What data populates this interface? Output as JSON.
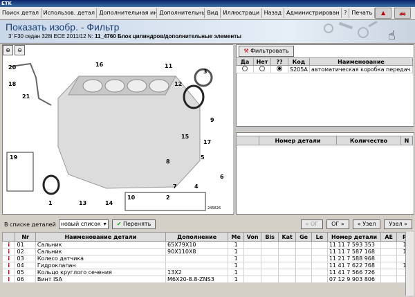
{
  "app": {
    "title": "ETK"
  },
  "menu": {
    "items": [
      "Поиск детал",
      "Использов. детал",
      "Дополнительная ин",
      "Дополнительны",
      "Вид",
      "Иллюстраци",
      "Назад",
      "Администрирован",
      "?",
      "Печать"
    ]
  },
  "header": {
    "title": "Показать изобр. - Фильтр",
    "subtitle_prefix": "3' F30 седан 328i ECE 2011/12 N: ",
    "subtitle_code": "11_4760",
    "subtitle_suffix": " Блок цилиндров/дополнительные элементы"
  },
  "filter": {
    "button": "Фильтровать",
    "columns": [
      "Да",
      "Нет",
      "??",
      "Код",
      "Наименование"
    ],
    "rows": [
      {
        "yes": false,
        "no": false,
        "unknown": true,
        "code": "S205A",
        "name": "автоматическая коробка передач"
      }
    ]
  },
  "parts_panel": {
    "columns": [
      "",
      "Номер детали",
      "Количество",
      "N"
    ]
  },
  "diagram": {
    "labels": [
      "1",
      "2",
      "3",
      "4",
      "5",
      "6",
      "7",
      "8",
      "9",
      "10",
      "11",
      "12",
      "13",
      "14",
      "15",
      "16",
      "17",
      "18",
      "19",
      "20",
      "21"
    ],
    "image_code": "245826"
  },
  "bottom": {
    "list_label": "В списке деталей",
    "list_value": "новый список",
    "transfer_button": "Перенять",
    "nav": [
      "« ОГ",
      "ОГ »",
      "« Узел",
      "Узел »"
    ]
  },
  "table": {
    "columns": [
      "",
      "Nr",
      "Наименование детали",
      "Дополнение",
      "Me",
      "Von",
      "Bis",
      "Kat",
      "Ge",
      "Le",
      "Номер детали",
      "AE",
      "R"
    ],
    "rows": [
      {
        "nr": "01",
        "name": "Сальник",
        "suffix": "65X79X10",
        "me": "1",
        "num": "11 11 7 593 353",
        "r": "1"
      },
      {
        "nr": "02",
        "name": "Сальник",
        "suffix": "90X110X8",
        "me": "1",
        "num": "11 11 7 587 168",
        "r": "1"
      },
      {
        "nr": "03",
        "name": "Колесо датчика",
        "suffix": "",
        "me": "1",
        "num": "11 21 7 588 968",
        "r": ""
      },
      {
        "nr": "04",
        "name": "Гидроклапан",
        "suffix": "",
        "me": "1",
        "num": "11 41 7 622 768",
        "r": "1"
      },
      {
        "nr": "05",
        "name": "Кольцо круглого сечения",
        "suffix": "13X2",
        "me": "1",
        "num": "11 41 7 566 726",
        "r": ""
      },
      {
        "nr": "06",
        "name": "Винт ISA",
        "suffix": "M6X20-8.8-ZNS3",
        "me": "1",
        "num": "07 12 9 903 806",
        "r": ""
      }
    ]
  }
}
